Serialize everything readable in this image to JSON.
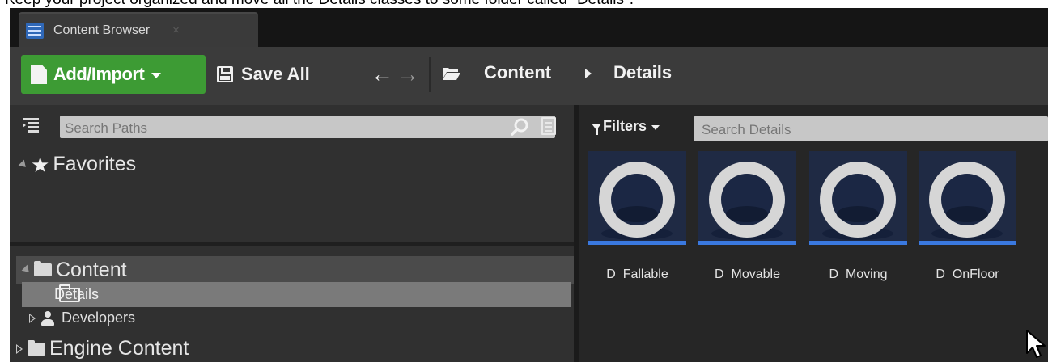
{
  "caption": "Keep your project organized and move all the Details classes to some folder called \"Details\".",
  "tab": {
    "label": "Content Browser",
    "close": "×"
  },
  "toolbar": {
    "add_label": "Add/Import",
    "save_label": "Save All",
    "back_glyph": "←",
    "forward_glyph": "→"
  },
  "breadcrumb": {
    "items": [
      "Content",
      "Details"
    ]
  },
  "paths_panel": {
    "search_placeholder": "Search Paths",
    "favorites_label": "Favorites",
    "tree": [
      {
        "label": "Content",
        "expanded": true
      },
      {
        "label": "Details",
        "selected": true
      },
      {
        "label": "Developers"
      },
      {
        "label": "Engine Content"
      }
    ]
  },
  "assets_panel": {
    "filters_label": "Filters",
    "search_placeholder": "Search Details",
    "assets": [
      {
        "name": "D_Fallable"
      },
      {
        "name": "D_Movable"
      },
      {
        "name": "D_Moving"
      },
      {
        "name": "D_OnFloor"
      }
    ]
  },
  "colors": {
    "add_button": "#3d9b34",
    "thumb_background": "#1f2a44",
    "thumb_bar": "#3a79e0",
    "tab_icon": "#2f68b8"
  }
}
